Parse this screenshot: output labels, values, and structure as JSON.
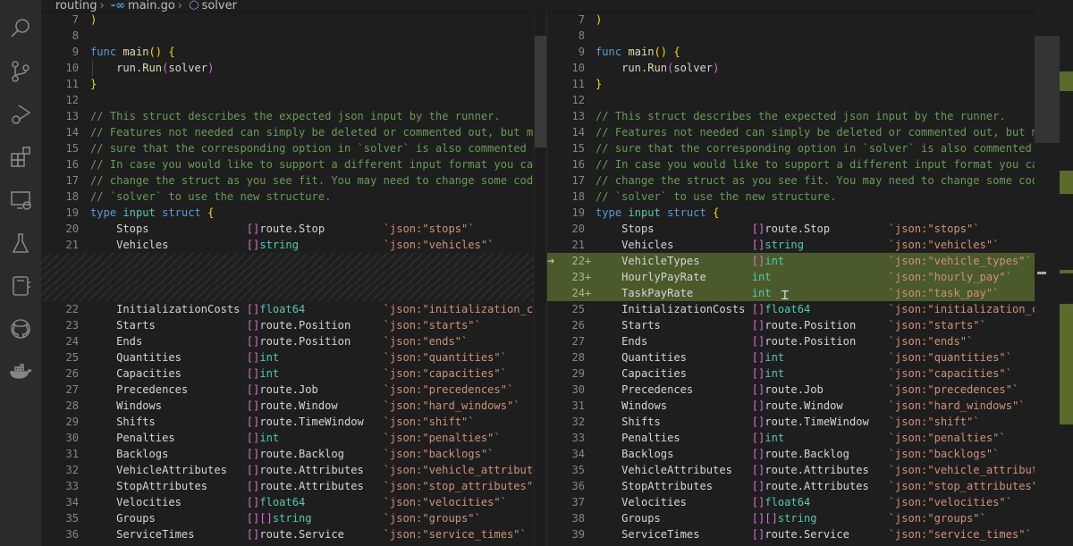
{
  "breadcrumb": {
    "folder": "routing",
    "file": "main.go",
    "symbol": "solver",
    "file_icon": "go-icon",
    "symbol_icon": "cube-icon"
  },
  "activity_bar": [
    "search-icon",
    "source-control-icon",
    "run-debug-icon",
    "extensions-icon",
    "remote-explorer-icon",
    "testing-icon",
    "notebook-icon",
    "github-icon",
    "docker-icon"
  ],
  "colors": {
    "added_background": "#4b5a2b",
    "keyword": "#569cd6",
    "comment": "#6a9955",
    "type": "#4ec9b0",
    "tag": "#ce9178"
  },
  "header_lines": [
    {
      "n": 7,
      "tokens": [
        [
          "br",
          ")"
        ]
      ]
    },
    {
      "n": 8,
      "tokens": []
    },
    {
      "n": 9,
      "tokens": [
        [
          "kw",
          "func "
        ],
        [
          "fn",
          "main"
        ],
        [
          "br",
          "() {"
        ]
      ]
    },
    {
      "n": 10,
      "tokens": [
        [
          "tx",
          "    run."
        ],
        [
          "fn",
          "Run"
        ],
        [
          "pb",
          "("
        ],
        [
          "tx",
          "solver"
        ],
        [
          "pb",
          ")"
        ]
      ]
    },
    {
      "n": 11,
      "tokens": [
        [
          "br",
          "}"
        ]
      ]
    },
    {
      "n": 12,
      "tokens": []
    },
    {
      "n": 13,
      "tokens": [
        [
          "cm",
          "// This struct describes the expected json input by the runner."
        ]
      ]
    },
    {
      "n": 14,
      "tokens": [
        [
          "cm",
          "// Features not needed can simply be deleted or commented out, but make"
        ]
      ]
    },
    {
      "n": 15,
      "tokens": [
        [
          "cm",
          "// sure that the corresponding option in `solver` is also commented out"
        ]
      ]
    },
    {
      "n": 16,
      "tokens": [
        [
          "cm",
          "// In case you would like to support a different input format you can"
        ]
      ]
    },
    {
      "n": 17,
      "tokens": [
        [
          "cm",
          "// change the struct as you see fit. You may need to change some code in"
        ]
      ]
    },
    {
      "n": 18,
      "tokens": [
        [
          "cm",
          "// `solver` to use the new structure."
        ]
      ]
    },
    {
      "n": 19,
      "tokens": [
        [
          "kw",
          "type "
        ],
        [
          "ty",
          "input "
        ],
        [
          "kw",
          "struct "
        ],
        [
          "br",
          "{"
        ]
      ]
    }
  ],
  "fields_before": [
    {
      "name": "Stops",
      "prefix": "[]",
      "type": "route.Stop",
      "tag": "`json:\"stops\"`"
    },
    {
      "name": "Vehicles",
      "prefix": "[]",
      "type": "string",
      "tag": "`json:\"vehicles\"`"
    }
  ],
  "fields_added": [
    {
      "name": "VehicleTypes",
      "prefix": "[]",
      "type": "int",
      "tag": "`json:\"vehicle_types\"`"
    },
    {
      "name": "HourlyPayRate",
      "prefix": "",
      "type": "int",
      "tag": "`json:\"hourly_pay\"`"
    },
    {
      "name": "TaskPayRate",
      "prefix": "",
      "type": "int",
      "tag": "`json:\"task_pay\"`"
    }
  ],
  "fields_after": [
    {
      "name": "InitializationCosts",
      "prefix": "[]",
      "type": "float64",
      "tag": "`json:\"initialization_costs\"`"
    },
    {
      "name": "Starts",
      "prefix": "[]",
      "type": "route.Position",
      "tag": "`json:\"starts\"`"
    },
    {
      "name": "Ends",
      "prefix": "[]",
      "type": "route.Position",
      "tag": "`json:\"ends\"`"
    },
    {
      "name": "Quantities",
      "prefix": "[]",
      "type": "int",
      "tag": "`json:\"quantities\"`"
    },
    {
      "name": "Capacities",
      "prefix": "[]",
      "type": "int",
      "tag": "`json:\"capacities\"`"
    },
    {
      "name": "Precedences",
      "prefix": "[]",
      "type": "route.Job",
      "tag": "`json:\"precedences\"`"
    },
    {
      "name": "Windows",
      "prefix": "[]",
      "type": "route.Window",
      "tag": "`json:\"hard_windows\"`"
    },
    {
      "name": "Shifts",
      "prefix": "[]",
      "type": "route.TimeWindow",
      "tag": "`json:\"shift\"`"
    },
    {
      "name": "Penalties",
      "prefix": "[]",
      "type": "int",
      "tag": "`json:\"penalties\"`"
    },
    {
      "name": "Backlogs",
      "prefix": "[]",
      "type": "route.Backlog",
      "tag": "`json:\"backlogs\"`"
    },
    {
      "name": "VehicleAttributes",
      "prefix": "[]",
      "type": "route.Attributes",
      "tag": "`json:\"vehicle_attributes\"`"
    },
    {
      "name": "StopAttributes",
      "prefix": "[]",
      "type": "route.Attributes",
      "tag": "`json:\"stop_attributes\"`"
    },
    {
      "name": "Velocities",
      "prefix": "[]",
      "type": "float64",
      "tag": "`json:\"velocities\"`"
    },
    {
      "name": "Groups",
      "prefix": "[][]",
      "type": "string",
      "tag": "`json:\"groups\"`"
    },
    {
      "name": "ServiceTimes",
      "prefix": "[]",
      "type": "route.Service",
      "tag": "`json:\"service_times\"`"
    }
  ],
  "diff": {
    "plus_marker": "+",
    "current_change_arrow": "→"
  }
}
